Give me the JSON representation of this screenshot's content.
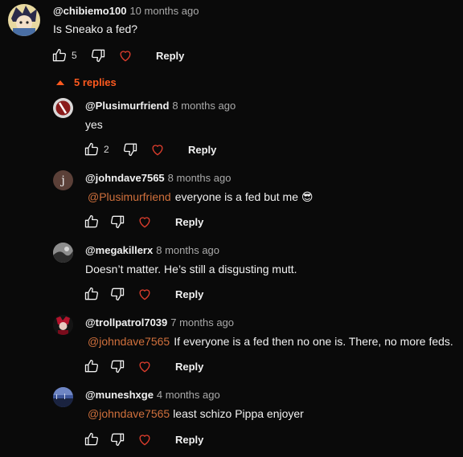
{
  "main_comment": {
    "author": "@chibiemo100",
    "time": "10 months ago",
    "text": "Is Sneako a fed?",
    "likes": "5",
    "reply_label": "Reply"
  },
  "replies_toggle": {
    "label": "5 replies"
  },
  "replies": [
    {
      "author": "@Plusimurfriend",
      "time": "8 months ago",
      "mention": "",
      "text": "yes",
      "likes": "2",
      "reply_label": "Reply"
    },
    {
      "author": "@johndave7565",
      "time": "8 months ago",
      "mention": "@Plusimurfriend",
      "text": "everyone is a fed but me 😎",
      "likes": "",
      "reply_label": "Reply",
      "avatar_letter": "j"
    },
    {
      "author": "@megakillerx",
      "time": "8 months ago",
      "mention": "",
      "text": "Doesn’t matter. He’s still a disgusting mutt.",
      "likes": "",
      "reply_label": "Reply"
    },
    {
      "author": "@trollpatrol7039",
      "time": "7 months ago",
      "mention": "@johndave7565",
      "text": "If everyone is a fed then no one is. There, no more feds.",
      "likes": "",
      "reply_label": "Reply"
    },
    {
      "author": "@muneshxge",
      "time": "4 months ago",
      "mention": "@johndave7565",
      "text": "least schizo Pippa enjoyer",
      "likes": "",
      "reply_label": "Reply"
    }
  ],
  "colors": {
    "accent": "#ff5a1f",
    "mention": "#d0703c",
    "background": "#0a0a0a"
  }
}
